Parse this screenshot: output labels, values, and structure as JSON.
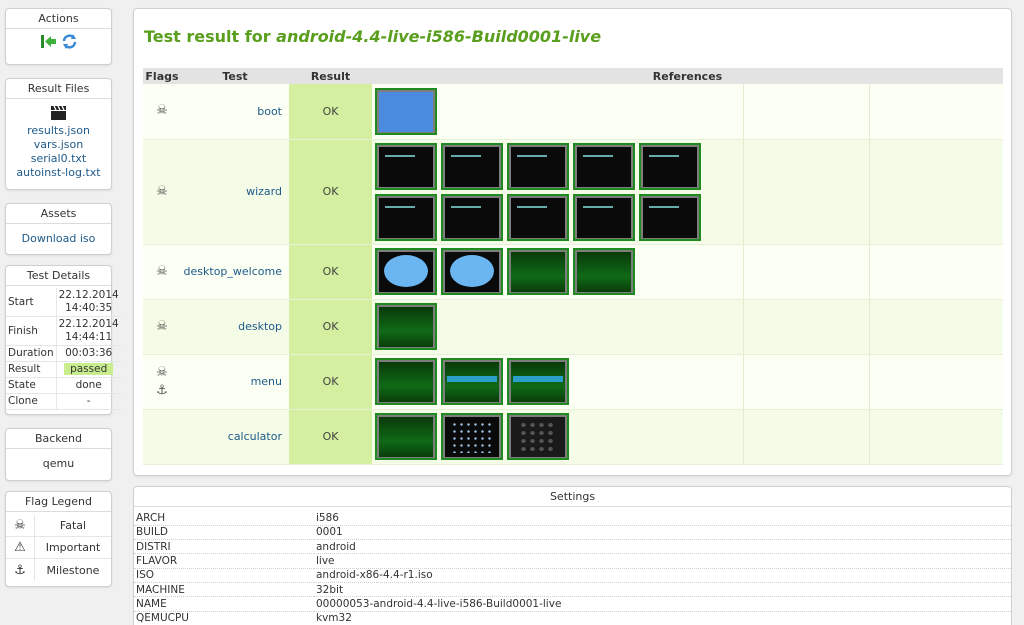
{
  "sidebar": {
    "actions": {
      "title": "Actions",
      "icons": [
        "back-to-job-group-icon",
        "restart-icon"
      ]
    },
    "result_files": {
      "title": "Result Files",
      "icon": "clapperboard-icon",
      "files": [
        "results.json",
        "vars.json",
        "serial0.txt",
        "autoinst-log.txt"
      ]
    },
    "assets": {
      "title": "Assets",
      "link": "Download iso"
    },
    "test_details": {
      "title": "Test Details",
      "rows": [
        {
          "key": "Start",
          "value": "22.12.2014\n14:40:35"
        },
        {
          "key": "Finish",
          "value": "22.12.2014\n14:44:11"
        },
        {
          "key": "Duration",
          "value": "00:03:36"
        },
        {
          "key": "Result",
          "value": "passed"
        },
        {
          "key": "State",
          "value": "done"
        },
        {
          "key": "Clone",
          "value": "-"
        }
      ]
    },
    "backend": {
      "title": "Backend",
      "value": "qemu"
    },
    "flag_legend": {
      "title": "Flag Legend",
      "items": [
        {
          "icon": "skull-icon",
          "glyph": "☠",
          "label": "Fatal"
        },
        {
          "icon": "warning-icon",
          "glyph": "⚠",
          "label": "Important"
        },
        {
          "icon": "anchor-icon",
          "glyph": "⚓",
          "label": "Milestone"
        }
      ]
    }
  },
  "main": {
    "title_prefix": "Test result for ",
    "title_name": "android-4.4-live-i586-Build0001-live",
    "columns": [
      "Flags",
      "Test",
      "Result",
      "References"
    ],
    "rows": [
      {
        "flags": [
          "☠"
        ],
        "test": "boot",
        "result": "OK",
        "thumbs": [
          "blue"
        ]
      },
      {
        "flags": [
          "☠"
        ],
        "test": "wizard",
        "result": "OK",
        "thumbs": [
          "dark",
          "dark",
          "dark",
          "dark",
          "dark",
          "dark",
          "dark",
          "dark",
          "dark",
          "dark"
        ]
      },
      {
        "flags": [
          "☠"
        ],
        "test": "desktop_welcome",
        "result": "OK",
        "thumbs": [
          "bubble",
          "bubble",
          "green",
          "green"
        ]
      },
      {
        "flags": [
          "☠"
        ],
        "test": "desktop",
        "result": "OK",
        "thumbs": [
          "green"
        ]
      },
      {
        "flags": [
          "☠",
          "⚓"
        ],
        "test": "menu",
        "result": "OK",
        "thumbs": [
          "green",
          "bar",
          "bar"
        ]
      },
      {
        "flags": [],
        "test": "calculator",
        "result": "OK",
        "thumbs": [
          "green",
          "grid",
          "keys"
        ]
      }
    ]
  },
  "settings": {
    "title": "Settings",
    "rows": [
      {
        "key": "ARCH",
        "value": "i586"
      },
      {
        "key": "BUILD",
        "value": "0001"
      },
      {
        "key": "DISTRI",
        "value": "android"
      },
      {
        "key": "FLAVOR",
        "value": "live"
      },
      {
        "key": "ISO",
        "value": "android-x86-4.4-r1.iso"
      },
      {
        "key": "MACHINE",
        "value": "32bit"
      },
      {
        "key": "NAME",
        "value": "00000053-android-4.4-live-i586-Build0001-live"
      },
      {
        "key": "QEMUCPU",
        "value": "kvm32"
      }
    ]
  },
  "colors": {
    "title_green": "#5a9e1d",
    "ok_green": "#d3ef9f",
    "thumb_border": "#1f8a1f"
  }
}
